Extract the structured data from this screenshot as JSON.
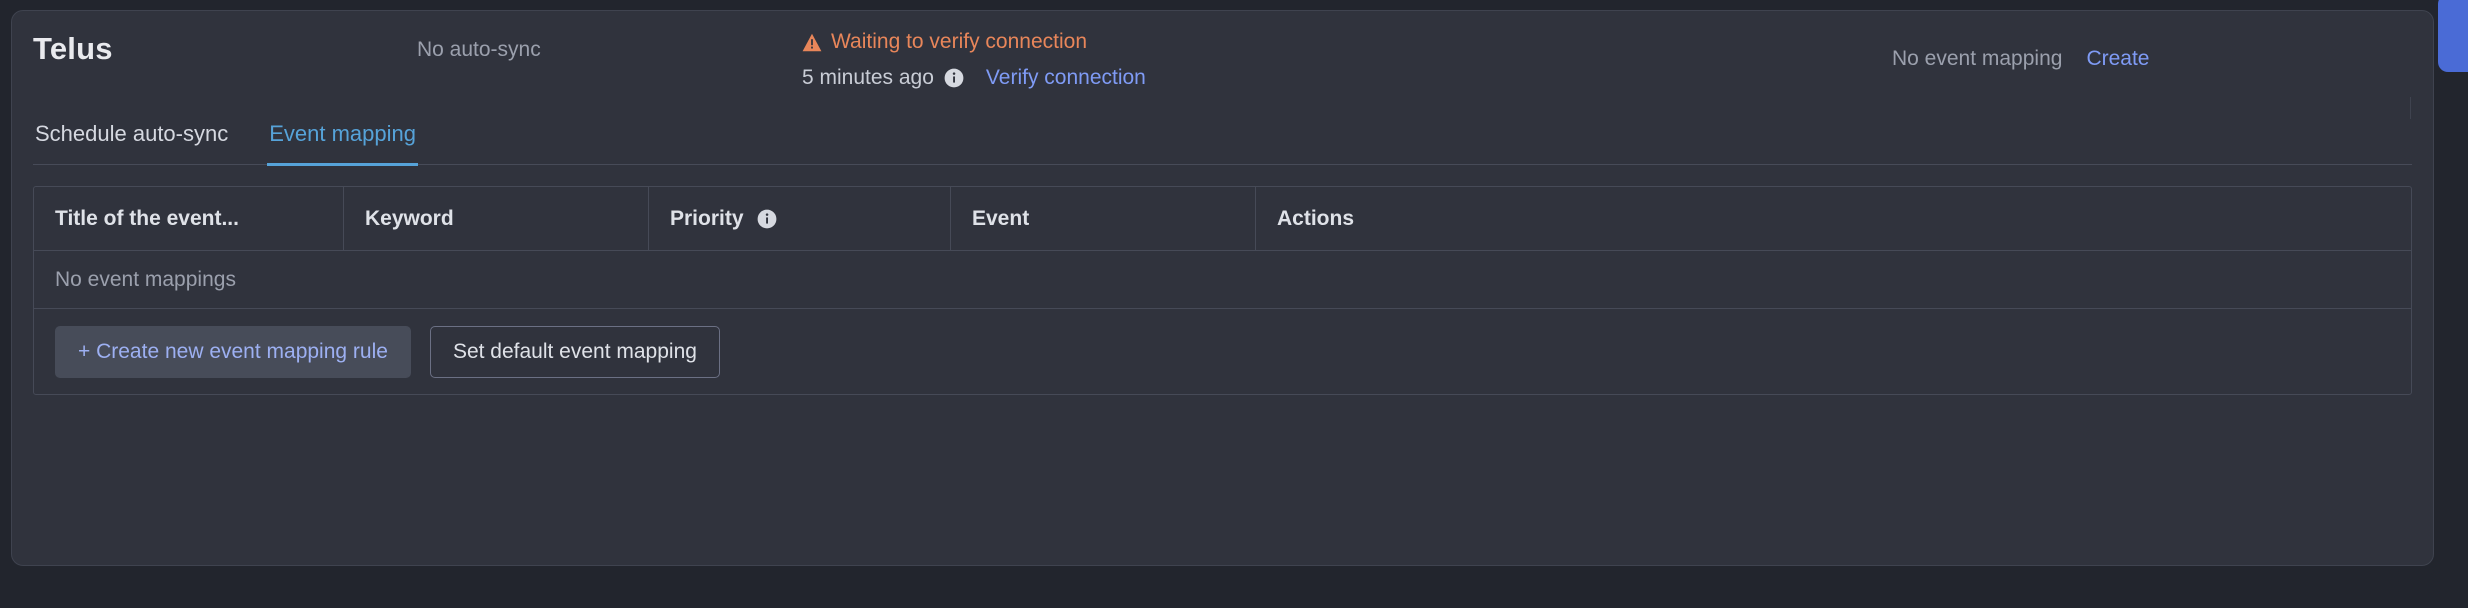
{
  "header": {
    "integration_name": "Telus",
    "autosync_status": "No auto-sync",
    "connection": {
      "warning_icon": "warning-triangle-icon",
      "status_text": "Waiting to verify connection",
      "timestamp": "5 minutes ago",
      "info_icon": "info-circle-icon",
      "verify_link": "Verify connection"
    },
    "event_mapping_status": "No event mapping",
    "create_link": "Create"
  },
  "tabs": [
    {
      "label": "Schedule auto-sync",
      "active": false
    },
    {
      "label": "Event mapping",
      "active": true
    }
  ],
  "table": {
    "columns": [
      {
        "label": "Title of the event...",
        "info": false
      },
      {
        "label": "Keyword",
        "info": false
      },
      {
        "label": "Priority",
        "info": true
      },
      {
        "label": "Event",
        "info": false
      },
      {
        "label": "Actions",
        "info": false
      }
    ],
    "empty_message": "No event mappings",
    "rows": []
  },
  "actions": {
    "create_rule_label": "+ Create new event mapping rule",
    "set_default_label": "Set default event mapping"
  },
  "edge_fab": {
    "name": "feedback-tab"
  },
  "colors": {
    "page_background": "#22252d",
    "card_background": "#30333d",
    "border": "#464a57",
    "warning": "#e8865a",
    "link": "#7f9bf5",
    "active_tab": "#56a3d9",
    "button_primary_text": "#9db0f2",
    "fab": "#4a6bd6",
    "muted_text": "#9ba0ad"
  }
}
